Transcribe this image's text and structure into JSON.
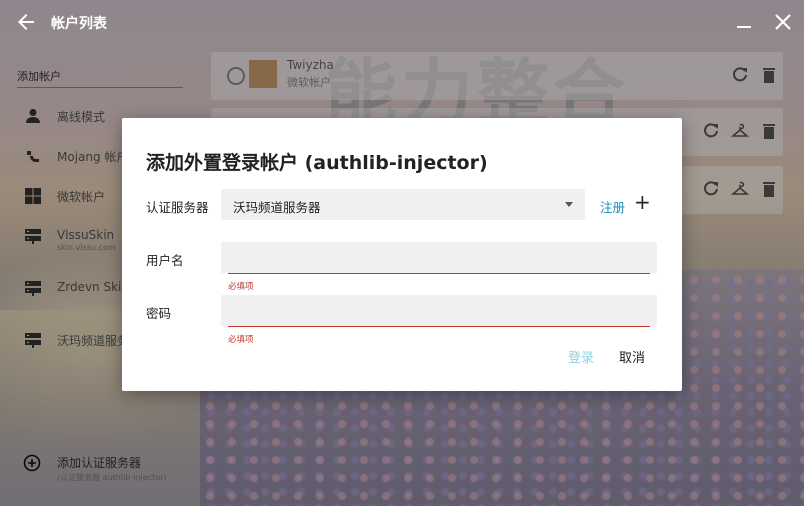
{
  "window": {
    "title": "帐户列表"
  },
  "background": {
    "logo_text": "能力整合"
  },
  "sidebar": {
    "header": "添加帐户",
    "items": [
      {
        "label": "离线模式",
        "sub": "",
        "icon": "person-icon"
      },
      {
        "label": "Mojang 帐户",
        "sub": "",
        "icon": "mojang-icon"
      },
      {
        "label": "微软帐户",
        "sub": "",
        "icon": "microsoft-icon"
      },
      {
        "label": "VlssuSkin",
        "sub": "skin.vlssu.com",
        "icon": "server-icon"
      },
      {
        "label": "Zrdevn Skin",
        "sub": "",
        "icon": "server-icon"
      },
      {
        "label": "沃玛频道服务器",
        "sub": "",
        "icon": "server-icon"
      }
    ],
    "add_server": {
      "label": "添加认证服务器",
      "sub": "(认证服务器 authlib-injector)"
    }
  },
  "accounts": [
    {
      "name": "Twiyzha",
      "type": "微软帐户"
    },
    {
      "name": "",
      "type": ""
    },
    {
      "name": "",
      "type": ""
    }
  ],
  "dialog": {
    "title": "添加外置登录帐户 (authlib-injector)",
    "server_label": "认证服务器",
    "server_value": "沃玛频道服务器",
    "register_label": "注册",
    "add_label": "+",
    "username_label": "用户名",
    "username_value": "",
    "username_error": "必填项",
    "password_label": "密码",
    "password_value": "",
    "password_error": "必填项",
    "login_label": "登录",
    "cancel_label": "取消"
  },
  "colors": {
    "accent": "#1a8fb0",
    "error": "#c0392b",
    "disabled": "#8fd0e3"
  }
}
